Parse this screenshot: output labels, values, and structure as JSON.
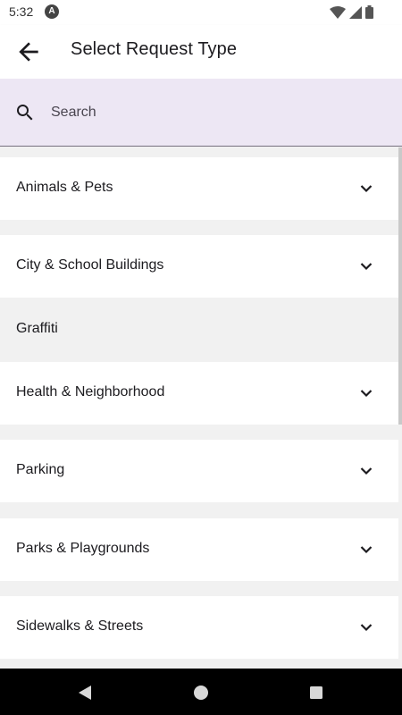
{
  "status_bar": {
    "time": "5:32",
    "app_icon": "A"
  },
  "header": {
    "title": "Select Request Type",
    "back_icon": "arrow-back"
  },
  "search": {
    "placeholder": "Search",
    "value": ""
  },
  "categories": [
    {
      "label": "Animals & Pets",
      "expandable": true
    },
    {
      "label": "City & School Buildings",
      "expandable": true
    },
    {
      "label": "Graffiti",
      "expandable": false
    },
    {
      "label": "Health & Neighborhood",
      "expandable": true
    },
    {
      "label": "Parking",
      "expandable": true
    },
    {
      "label": "Parks & Playgrounds",
      "expandable": true
    },
    {
      "label": "Sidewalks & Streets",
      "expandable": true
    }
  ],
  "colors": {
    "search_bg": "#ede7f4",
    "list_bg": "#f1f1f1",
    "item_bg": "#ffffff",
    "text": "#1c1b1f"
  }
}
